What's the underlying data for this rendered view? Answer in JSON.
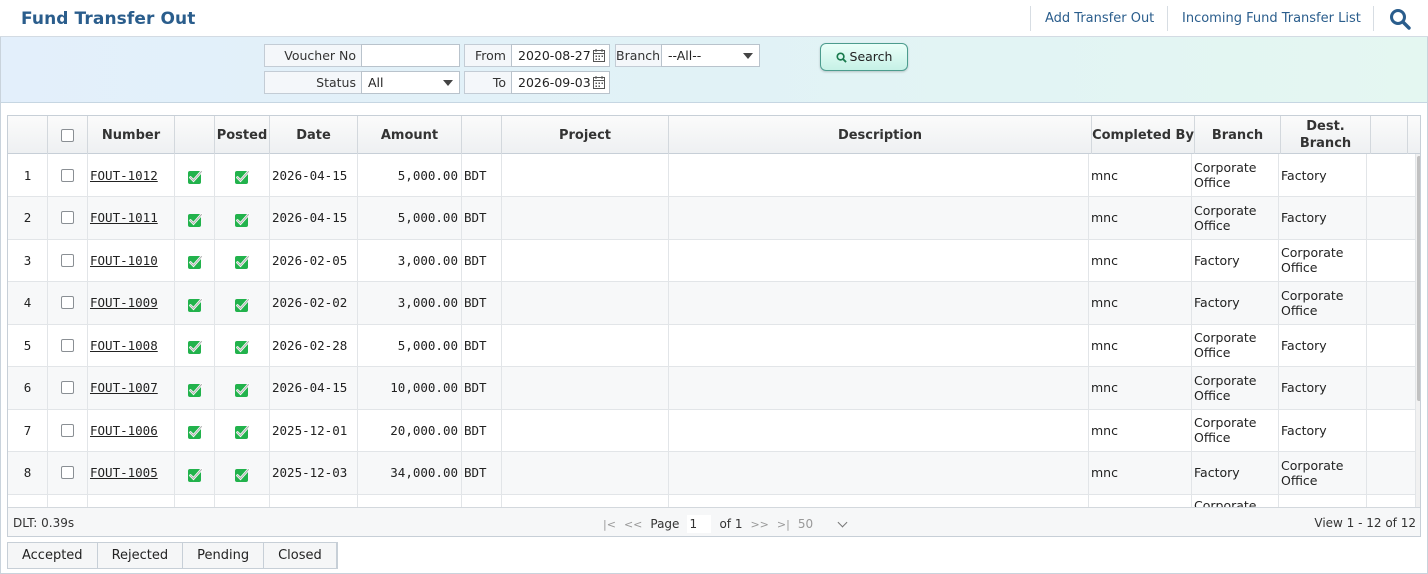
{
  "header": {
    "title": "Fund Transfer Out",
    "add_link": "Add Transfer Out",
    "incoming_link": "Incoming Fund Transfer List"
  },
  "filters": {
    "voucher_label": "Voucher No",
    "voucher_value": "",
    "from_label": "From",
    "from_value": "2020-08-27",
    "branch_label": "Branch",
    "branch_value": "--All--",
    "status_label": "Status",
    "status_value": "All",
    "to_label": "To",
    "to_value": "2026-09-03",
    "search_label": "Search"
  },
  "grid": {
    "columns": {
      "number": "Number",
      "posted": "Posted",
      "date": "Date",
      "amount": "Amount",
      "project": "Project",
      "description": "Description",
      "completed_by": "Completed By",
      "branch": "Branch",
      "dest_branch": "Dest. Branch"
    },
    "rows": [
      {
        "idx": "1",
        "number": "FOUT-1012",
        "date": "2026-04-15",
        "amount": "5,000.00",
        "currency": "BDT",
        "project": "",
        "description": "",
        "completed_by": "mnc",
        "branch": "Corporate Office",
        "dest_branch": "Factory"
      },
      {
        "idx": "2",
        "number": "FOUT-1011",
        "date": "2026-04-15",
        "amount": "5,000.00",
        "currency": "BDT",
        "project": "",
        "description": "",
        "completed_by": "mnc",
        "branch": "Corporate Office",
        "dest_branch": "Factory"
      },
      {
        "idx": "3",
        "number": "FOUT-1010",
        "date": "2026-02-05",
        "amount": "3,000.00",
        "currency": "BDT",
        "project": "",
        "description": "",
        "completed_by": "mnc",
        "branch": "Factory",
        "dest_branch": "Corporate Office"
      },
      {
        "idx": "4",
        "number": "FOUT-1009",
        "date": "2026-02-02",
        "amount": "3,000.00",
        "currency": "BDT",
        "project": "",
        "description": "",
        "completed_by": "mnc",
        "branch": "Factory",
        "dest_branch": "Corporate Office"
      },
      {
        "idx": "5",
        "number": "FOUT-1008",
        "date": "2026-02-28",
        "amount": "5,000.00",
        "currency": "BDT",
        "project": "",
        "description": "",
        "completed_by": "mnc",
        "branch": "Corporate Office",
        "dest_branch": "Factory"
      },
      {
        "idx": "6",
        "number": "FOUT-1007",
        "date": "2026-04-15",
        "amount": "10,000.00",
        "currency": "BDT",
        "project": "",
        "description": "",
        "completed_by": "mnc",
        "branch": "Corporate Office",
        "dest_branch": "Factory"
      },
      {
        "idx": "7",
        "number": "FOUT-1006",
        "date": "2025-12-01",
        "amount": "20,000.00",
        "currency": "BDT",
        "project": "",
        "description": "",
        "completed_by": "mnc",
        "branch": "Corporate Office",
        "dest_branch": "Factory"
      },
      {
        "idx": "8",
        "number": "FOUT-1005",
        "date": "2025-12-03",
        "amount": "34,000.00",
        "currency": "BDT",
        "project": "",
        "description": "",
        "completed_by": "mnc",
        "branch": "Factory",
        "dest_branch": "Corporate Office"
      },
      {
        "idx": "",
        "number": "",
        "date": "",
        "amount": "",
        "currency": "",
        "project": "",
        "description": "",
        "completed_by": "",
        "branch": "Corporate",
        "dest_branch": ""
      }
    ]
  },
  "footer": {
    "dlt": "DLT: 0.39s",
    "page_label": "Page",
    "page_value": "1",
    "of_label": "of 1",
    "page_size": "50",
    "view_text": "View 1 - 12 of 12"
  },
  "tabs": [
    "Accepted",
    "Rejected",
    "Pending",
    "Closed"
  ],
  "colors": {
    "title": "#2a5d8c",
    "check_green": "#22b24c",
    "search_btn": "#c6f1e6"
  },
  "icons": {
    "search": "search-icon",
    "calendar": "calendar-icon",
    "check": "check-icon"
  }
}
